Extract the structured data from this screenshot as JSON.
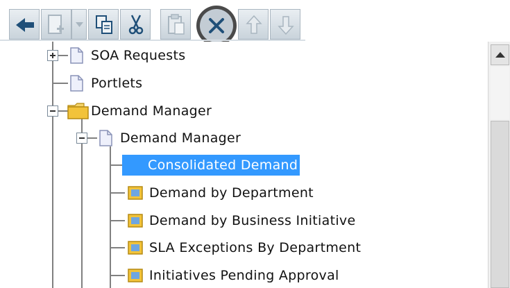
{
  "toolbar": {
    "buttons": [
      {
        "name": "back",
        "icon": "back-arrow-icon"
      },
      {
        "name": "new-document",
        "icon": "new-document-icon"
      },
      {
        "name": "dropdown",
        "icon": "chevron-down-icon"
      },
      {
        "name": "copy",
        "icon": "copy-icon"
      },
      {
        "name": "cut",
        "icon": "cut-icon"
      },
      {
        "name": "paste",
        "icon": "paste-icon"
      },
      {
        "name": "delete",
        "icon": "delete-x-icon"
      },
      {
        "name": "move-up",
        "icon": "arrow-up-icon"
      },
      {
        "name": "move-down",
        "icon": "arrow-down-icon"
      }
    ]
  },
  "tree": {
    "nodes": [
      {
        "label": "SOA Requests",
        "icon": "page-icon",
        "expander": "plus"
      },
      {
        "label": "Portlets",
        "icon": "page-icon",
        "expander": "none"
      },
      {
        "label": "Demand Manager",
        "icon": "folder-open-icon",
        "expander": "minus"
      },
      {
        "label": "Demand Manager",
        "icon": "page-icon",
        "expander": "minus"
      },
      {
        "label": "Consolidated Demand",
        "icon": "portlet-icon",
        "selected": true
      },
      {
        "label": "Demand by Department",
        "icon": "portlet-icon"
      },
      {
        "label": "Demand by Business Initiative",
        "icon": "portlet-icon"
      },
      {
        "label": "SLA Exceptions By Department",
        "icon": "portlet-icon"
      },
      {
        "label": "Initiatives Pending Approval",
        "icon": "portlet-icon"
      }
    ]
  },
  "colors": {
    "selection": "#3399ff",
    "toolbar_icon": "#1f4f78",
    "disabled_icon": "#a9b6c0",
    "folder": "#f2c33a"
  }
}
